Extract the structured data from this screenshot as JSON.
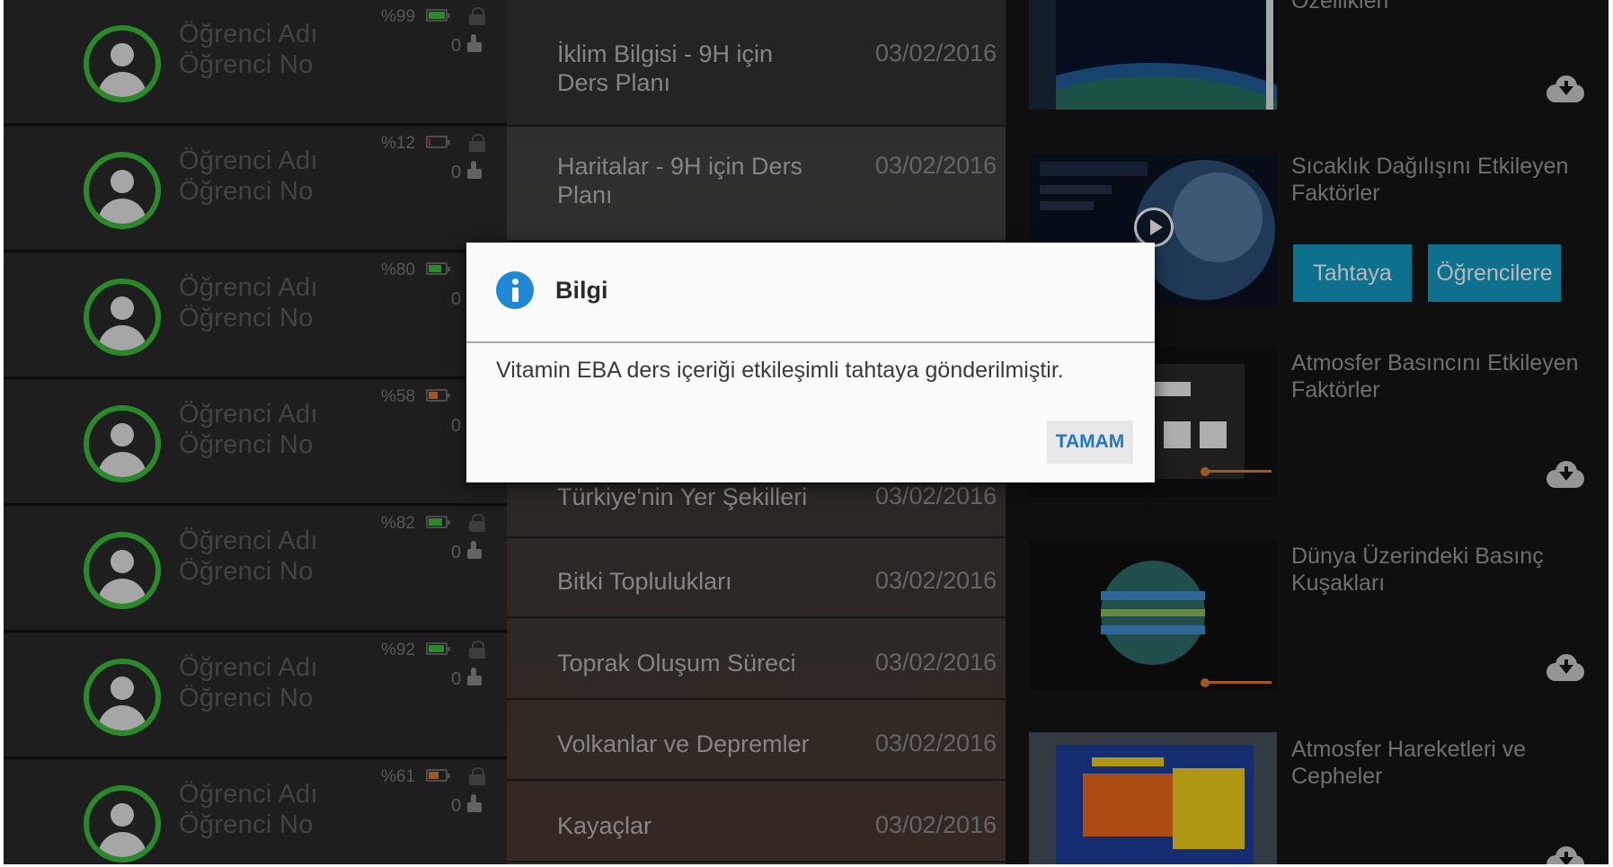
{
  "students": {
    "items": [
      {
        "name": "Öğrenci Adı",
        "number": "Öğrenci No",
        "battery_pct_label": "%99",
        "battery_level": 0.99,
        "battery_color": "#3bbf3b",
        "likes": "0"
      },
      {
        "name": "Öğrenci Adı",
        "number": "Öğrenci No",
        "battery_pct_label": "%12",
        "battery_level": 0.12,
        "battery_color": "#d32f2f",
        "likes": "0"
      },
      {
        "name": "Öğrenci Adı",
        "number": "Öğrenci No",
        "battery_pct_label": "%80",
        "battery_level": 0.8,
        "battery_color": "#3bbf3b",
        "likes": "0"
      },
      {
        "name": "Öğrenci Adı",
        "number": "Öğrenci No",
        "battery_pct_label": "%58",
        "battery_level": 0.58,
        "battery_color": "#e07a2a",
        "likes": "0"
      },
      {
        "name": "Öğrenci Adı",
        "number": "Öğrenci No",
        "battery_pct_label": "%82",
        "battery_level": 0.82,
        "battery_color": "#3bbf3b",
        "likes": "0"
      },
      {
        "name": "Öğrenci Adı",
        "number": "Öğrenci No",
        "battery_pct_label": "%92",
        "battery_level": 0.92,
        "battery_color": "#3bbf3b",
        "likes": "0"
      },
      {
        "name": "Öğrenci Adı",
        "number": "Öğrenci No",
        "battery_pct_label": "%61",
        "battery_level": 0.61,
        "battery_color": "#e07a2a",
        "likes": "0"
      }
    ]
  },
  "lessons": {
    "items": [
      {
        "title": "İklim Bilgisi - 9H için Ders Planı",
        "date": "03/02/2016"
      },
      {
        "title": "Haritalar - 9H için Ders Planı",
        "date": "03/02/2016"
      },
      {
        "title": "",
        "date": ""
      },
      {
        "title": "",
        "date": ""
      },
      {
        "title": "",
        "date": ""
      },
      {
        "title": "Türkiye'nin Yer Şekilleri",
        "date": "03/02/2016"
      },
      {
        "title": "Bitki Toplulukları",
        "date": "03/02/2016"
      },
      {
        "title": "Toprak Oluşum Süreci",
        "date": "03/02/2016"
      },
      {
        "title": "Volkanlar ve Depremler",
        "date": "03/02/2016"
      },
      {
        "title": "Kayaçlar",
        "date": "03/02/2016"
      }
    ]
  },
  "content": {
    "items": [
      {
        "title": "Özellikleri",
        "icon": "cloud-download-icon"
      },
      {
        "title": "Sıcaklık Dağılışını Etkileyen Faktörler",
        "icon": "play-icon",
        "buttons": [
          "Tahtaya",
          "Öğrencilere"
        ]
      },
      {
        "title": "Atmosfer Basıncını Etkileyen Faktörler",
        "icon": "cloud-download-icon"
      },
      {
        "title": "Dünya Üzerindeki Basınç Kuşakları",
        "icon": "cloud-download-icon"
      },
      {
        "title": "Atmosfer Hareketleri ve Cepheler",
        "icon": "cloud-download-icon"
      }
    ],
    "accent": "#139cc3"
  },
  "dialog": {
    "title": "Bilgi",
    "message": "Vitamin EBA ders içeriği etkileşimli tahtaya gönderilmiştir.",
    "ok_label": "TAMAM",
    "icon": "info-icon"
  }
}
